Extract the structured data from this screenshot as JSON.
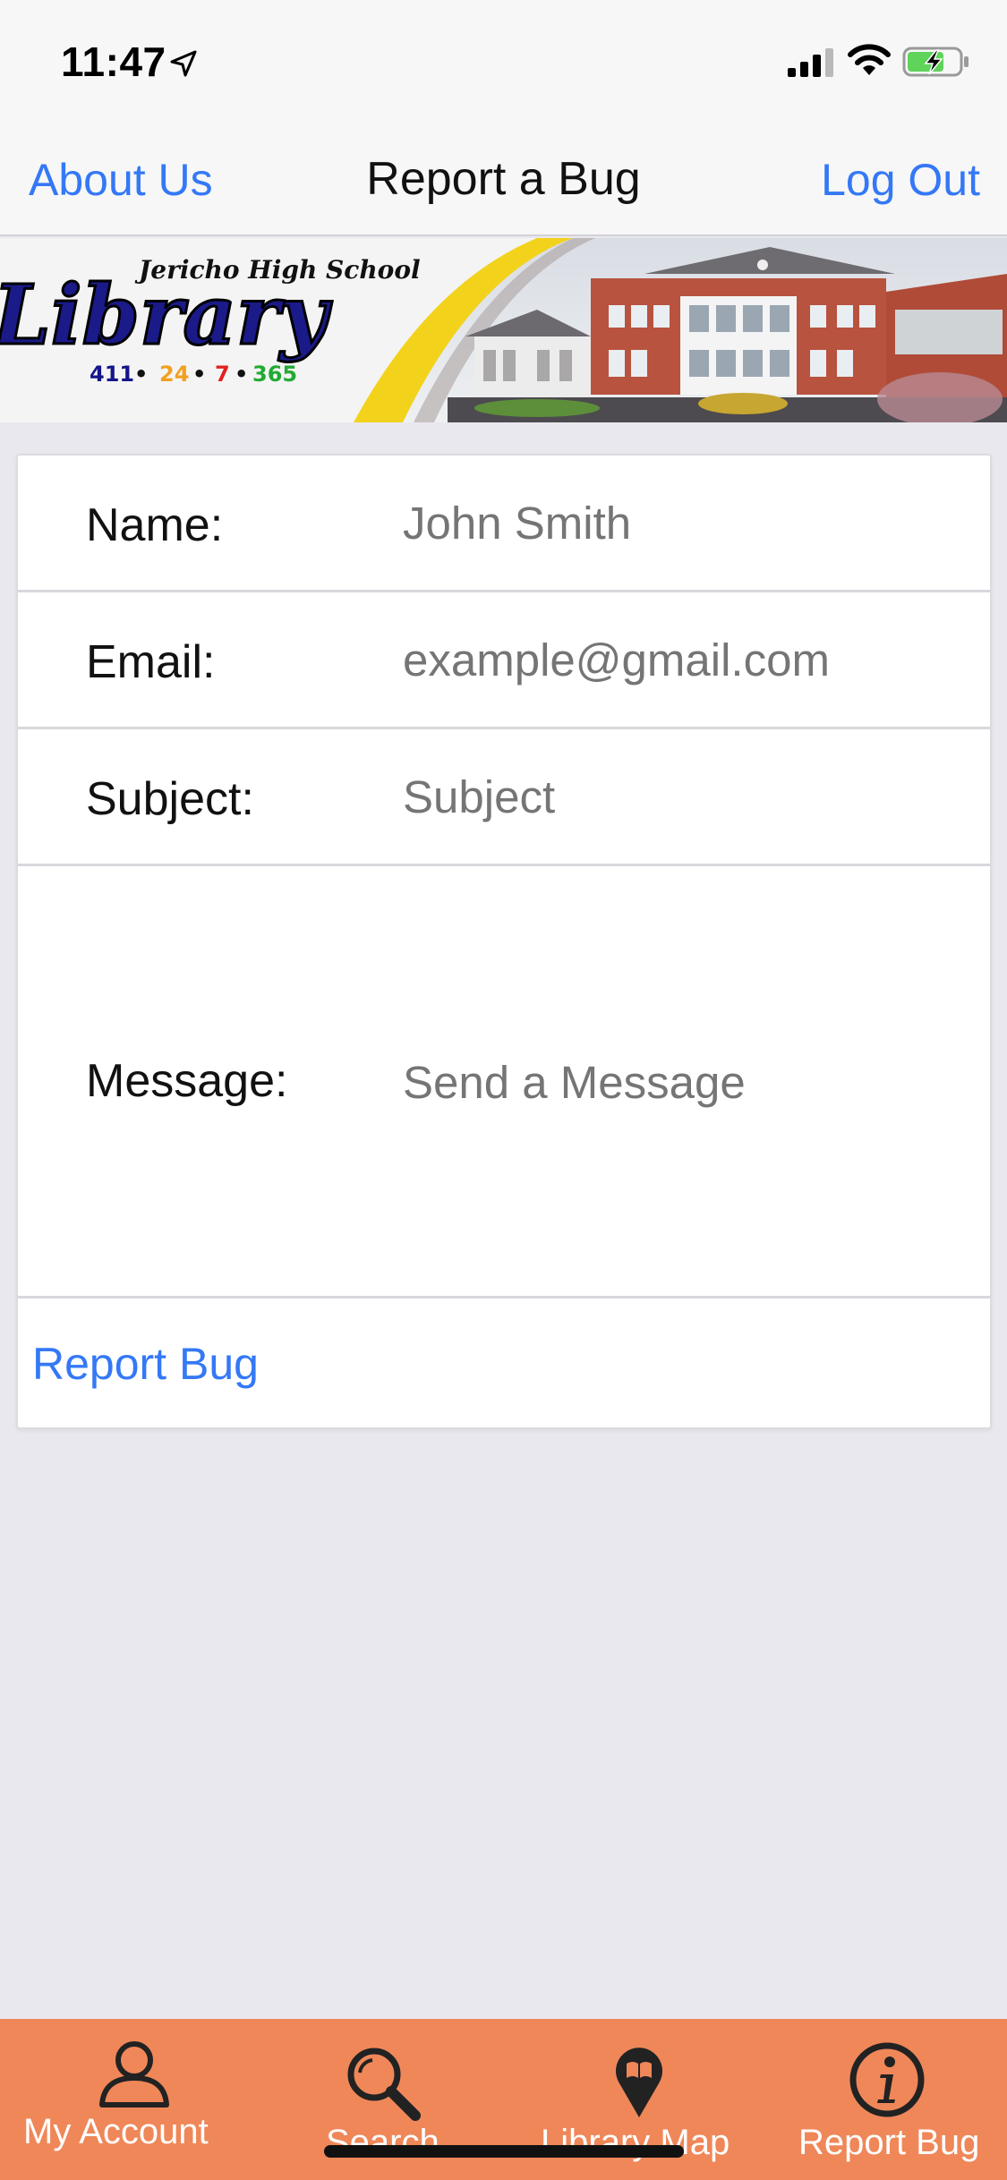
{
  "status_bar": {
    "time": "11:47",
    "icons": [
      "location-arrow-icon",
      "cellular-signal-icon",
      "wifi-icon",
      "battery-charging-icon"
    ]
  },
  "nav": {
    "left_label": "About Us",
    "title": "Report a Bug",
    "right_label": "Log Out",
    "accent_color": "#3478f6"
  },
  "banner": {
    "school_name": "Jericho High School",
    "word": "Library",
    "hours": [
      "411",
      "24",
      "7",
      "365"
    ]
  },
  "form": {
    "fields": [
      {
        "label": "Name:",
        "placeholder": "John Smith"
      },
      {
        "label": "Email:",
        "placeholder": "example@gmail.com"
      },
      {
        "label": "Subject:",
        "placeholder": "Subject"
      },
      {
        "label": "Message:",
        "placeholder": "Send a Message"
      }
    ],
    "submit_label": "Report Bug"
  },
  "tab_bar": {
    "background_color": "#ef8759",
    "tabs": [
      {
        "label": "My Account",
        "icon": "person-icon"
      },
      {
        "label": "Search",
        "icon": "search-icon"
      },
      {
        "label": "Library Map",
        "icon": "map-pin-book-icon"
      },
      {
        "label": "Report Bug",
        "icon": "info-icon"
      }
    ]
  }
}
